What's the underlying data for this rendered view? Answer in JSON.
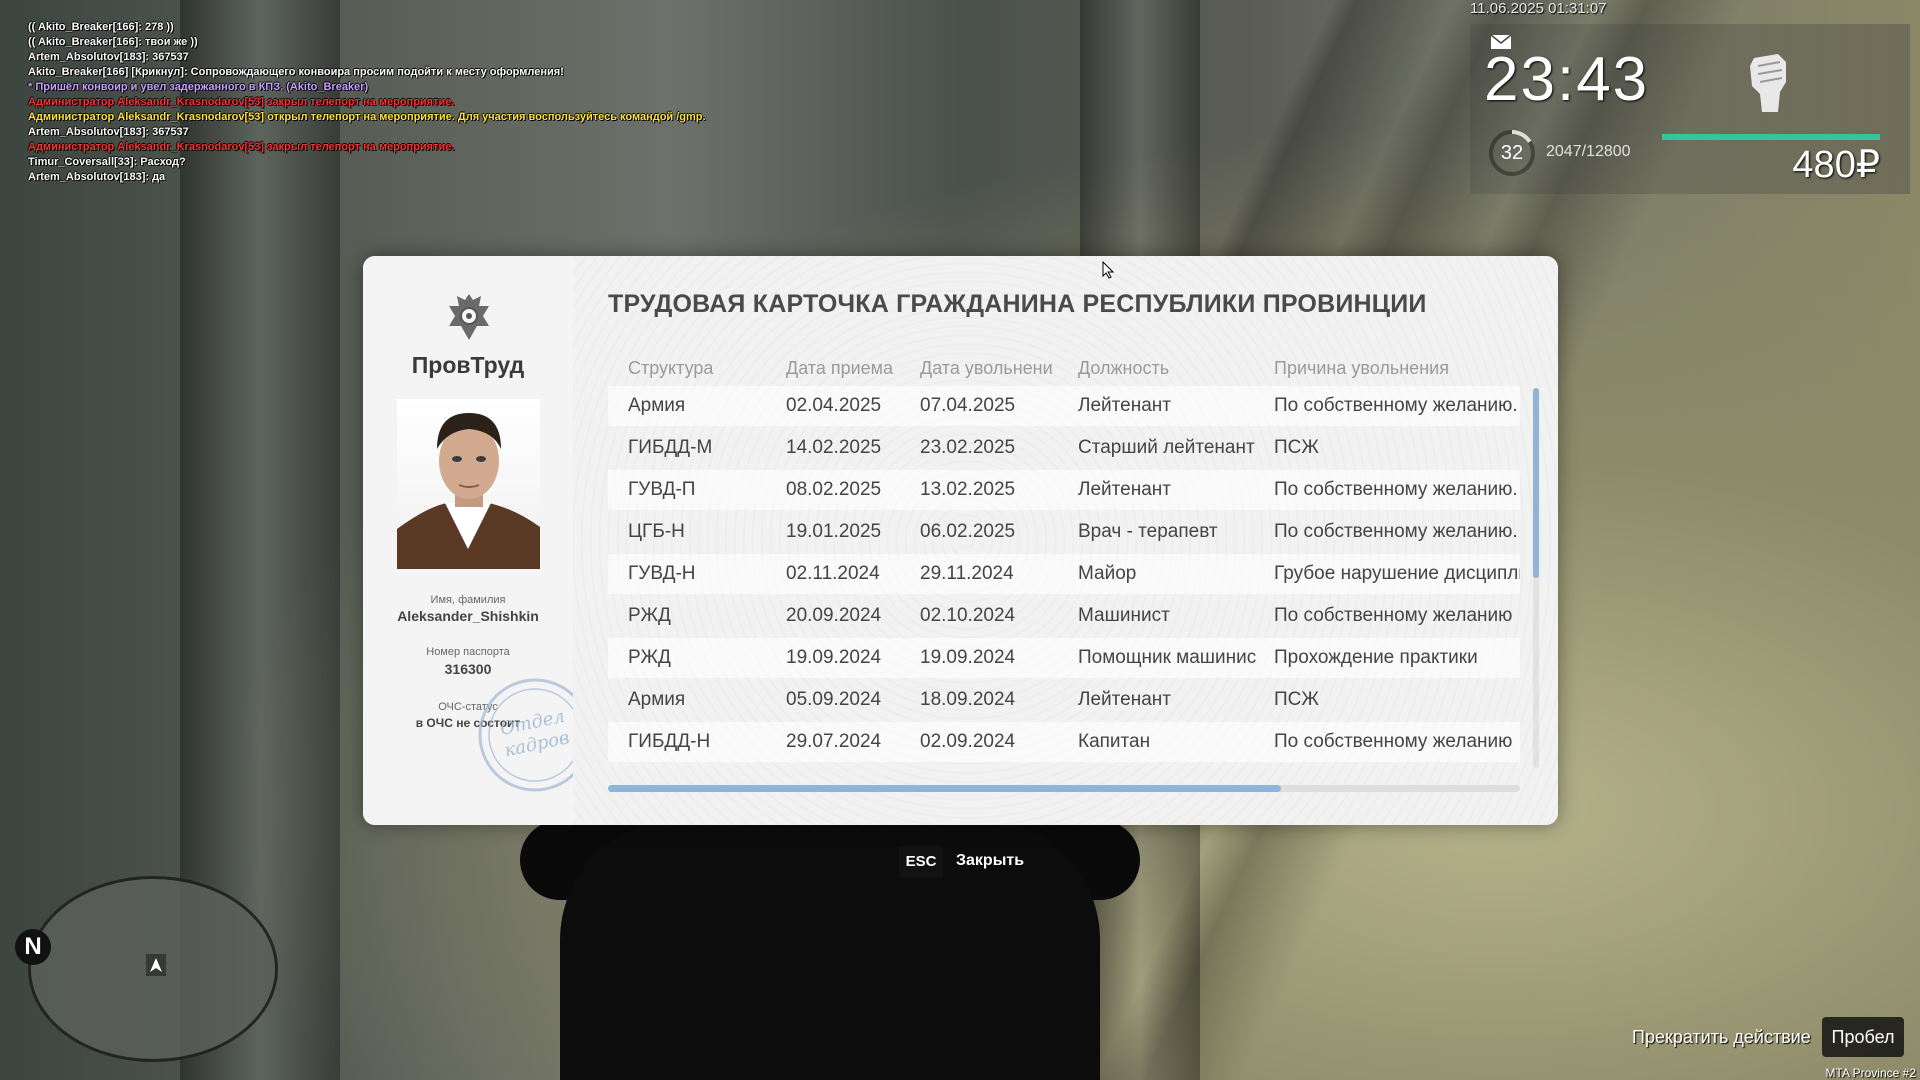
{
  "chat": [
    {
      "text": "(( Akito_Breaker[166]: 278 ))",
      "color": "#ffffff"
    },
    {
      "text": "(( Akito_Breaker[166]: твои же ))",
      "color": "#ffffff"
    },
    {
      "text": "Artem_Absolutov[183]: 367537",
      "color": "#ffffff"
    },
    {
      "text": "Akito_Breaker[166] [Крикнул]: Сопровождающего конвоира просим подойти к месту оформления!",
      "color": "#ffffff"
    },
    {
      "text": "* Пришёл конвоир и увел задержанного в КПЗ. (Akito_Breaker)",
      "color": "#c9a2ff"
    },
    {
      "text": "Администратор Aleksandr_Krasnodarov[53] закрыл телепорт на мероприятие.",
      "color": "#ff3030"
    },
    {
      "text": "Администратор Aleksandr_Krasnodarov[53] открыл телепорт на мероприятие. Для участия воспользуйтесь командой /gmp.",
      "color": "#ffe23a"
    },
    {
      "text": "Artem_Absolutov[183]: 367537",
      "color": "#ffffff"
    },
    {
      "text": "Администратор Aleksandr_Krasnodarov[53] закрыл телепорт на мероприятие.",
      "color": "#ff3030"
    },
    {
      "text": "Timur_Coversall[33]: Расход?",
      "color": "#ffffff"
    },
    {
      "text": "Artem_Absolutov[183]: да",
      "color": "#ffffff"
    }
  ],
  "hud": {
    "datetime": "11.06.2025 01:31:07",
    "time": "23:43",
    "level": "32",
    "xp": "2047/12800",
    "xp_fraction": 0.16,
    "money": "480₽",
    "icons": [
      "mail-icon",
      "fist-icon"
    ]
  },
  "modal": {
    "title": "ТРУДОВАЯ КАРТОЧКА ГРАЖДАНИНА РЕСПУБЛИКИ ПРОВИНЦИИ",
    "org_name": "ПровТруд",
    "name_label": "Имя, фамилия",
    "name_value": "Aleksander_Shishkin",
    "passport_label": "Номер паспорта",
    "passport_value": "316300",
    "status_label": "ОЧС-статус",
    "status_value": "в ОЧС не состоит",
    "stamp_text": [
      "Отдел",
      "кадров"
    ],
    "columns": [
      "Структура",
      "Дата приема",
      "Дата увольнени",
      "Должность",
      "Причина увольнения"
    ],
    "rows": [
      [
        "Армия",
        "02.04.2025",
        "07.04.2025",
        "Лейтенант",
        "По собственному желанию."
      ],
      [
        "ГИБДД-М",
        "14.02.2025",
        "23.02.2025",
        "Старший лейтенант",
        "ПСЖ"
      ],
      [
        "ГУВД-П",
        "08.02.2025",
        "13.02.2025",
        "Лейтенант",
        "По собственному желанию."
      ],
      [
        "ЦГБ-Н",
        "19.01.2025",
        "06.02.2025",
        "Врач - терапевт",
        "По собственному желанию."
      ],
      [
        "ГУВД-Н",
        "02.11.2024",
        "29.11.2024",
        "Майор",
        "Грубое нарушение дисциплин"
      ],
      [
        "РЖД",
        "20.09.2024",
        "02.10.2024",
        "Машинист",
        "По собственному желанию"
      ],
      [
        "РЖД",
        "19.09.2024",
        "19.09.2024",
        "Помощник машинис",
        "Прохождение практики"
      ],
      [
        "Армия",
        "05.09.2024",
        "18.09.2024",
        "Лейтенант",
        "ПСЖ"
      ],
      [
        "ГИБДД-Н",
        "29.07.2024",
        "02.09.2024",
        "Капитан",
        "По собственному желанию"
      ]
    ]
  },
  "hints": {
    "esc_key": "ESC",
    "esc_label": "Закрыть",
    "action_label": "Прекратить действие",
    "space_key": "Пробел"
  },
  "minimap": {
    "north": "N"
  },
  "server": "MTA Province #2"
}
